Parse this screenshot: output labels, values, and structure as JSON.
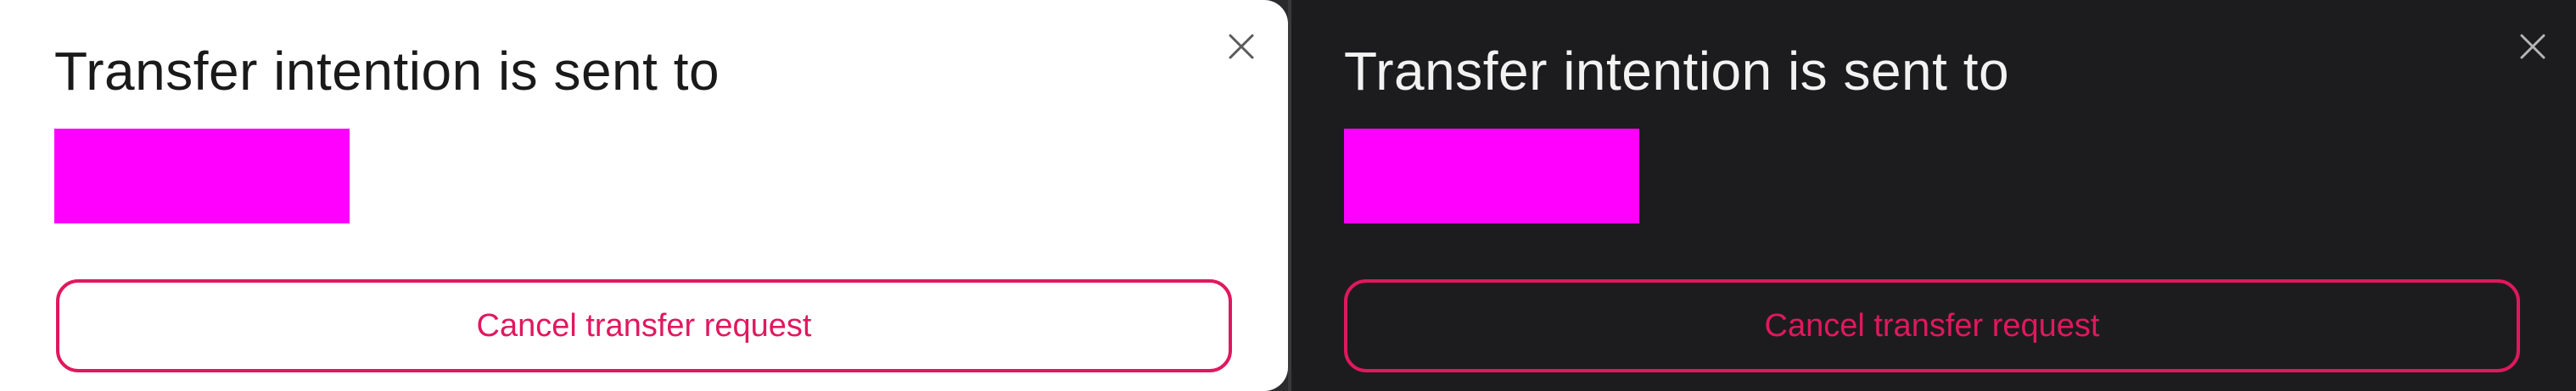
{
  "dialogs": [
    {
      "theme": "light",
      "title": "Transfer intention is sent to",
      "redacted_color": "#ff00ff",
      "close_icon": "close-icon",
      "cancel_label": "Cancel transfer request",
      "accent_color": "#e0185e"
    },
    {
      "theme": "dark",
      "title": "Transfer intention is sent to",
      "redacted_color": "#ff00ff",
      "close_icon": "close-icon",
      "cancel_label": "Cancel transfer request",
      "accent_color": "#e0185e"
    }
  ]
}
